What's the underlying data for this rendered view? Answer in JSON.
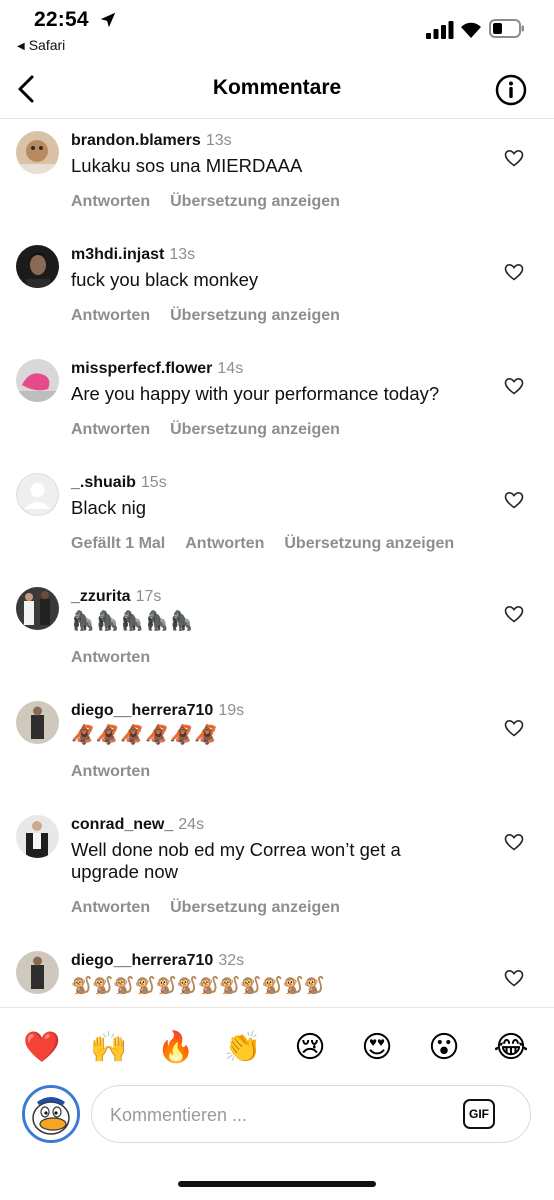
{
  "status_bar": {
    "time": "22:54",
    "back_app": "Safari"
  },
  "header": {
    "title": "Kommentare"
  },
  "comments": [
    {
      "username": "brandon.blamers",
      "time": "13s",
      "text": "Lukaku sos una MIERDAAA",
      "actions": [
        "Antworten",
        "Übersetzung anzeigen"
      ]
    },
    {
      "username": "m3hdi.injast",
      "time": "13s",
      "text": "fuck you black monkey",
      "actions": [
        "Antworten",
        "Übersetzung anzeigen"
      ]
    },
    {
      "username": "missperfecf.flower",
      "time": "14s",
      "text": "Are you happy with your performance today?",
      "actions": [
        "Antworten",
        "Übersetzung anzeigen"
      ]
    },
    {
      "username": "_.shuaib",
      "time": "15s",
      "text": "Black nig",
      "actions": [
        "Gefällt 1 Mal",
        "Antworten",
        "Übersetzung anzeigen"
      ]
    },
    {
      "username": "_zzurita",
      "time": "17s",
      "text": "🦍🦍🦍🦍🦍",
      "actions": [
        "Antworten"
      ]
    },
    {
      "username": "diego__herrera710",
      "time": "19s",
      "text": "🦧🦧🦧🦧🦧🦧",
      "actions": [
        "Antworten"
      ]
    },
    {
      "username": "conrad_new_",
      "time": "24s",
      "text": "Well done nob ed my Correa won’t get a upgrade now",
      "actions": [
        "Antworten",
        "Übersetzung anzeigen"
      ]
    },
    {
      "username": "diego__herrera710",
      "time": "32s",
      "text": "🐒🐒🐒🐒🐒🐒🐒🐒🐒🐒🐒🐒",
      "actions": []
    }
  ],
  "reactions": [
    "❤️",
    "🙌",
    "🔥",
    "👏",
    "😢",
    "😍",
    "😮",
    "😂"
  ],
  "composer": {
    "placeholder": "Kommentieren ...",
    "gif_label": "GIF"
  },
  "colors": {
    "secondary_text": "#8e8e8e",
    "avatar_ring": "#3a7bd5"
  }
}
